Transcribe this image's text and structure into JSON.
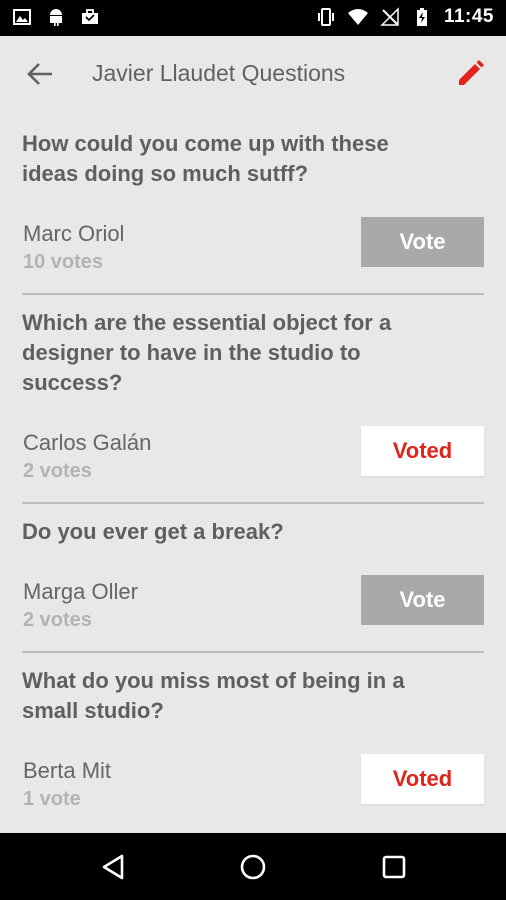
{
  "status_bar": {
    "time": "11:45",
    "left_icons": [
      "image-icon",
      "android-icon",
      "briefcase-icon"
    ],
    "right_icons": [
      "vibrate-icon",
      "wifi-icon",
      "no-signal-icon",
      "battery-charging-icon"
    ]
  },
  "toolbar": {
    "title": "Javier Llaudet Questions",
    "back_icon": "back-arrow-icon",
    "edit_icon": "pencil-icon"
  },
  "colors": {
    "accent": "#e2231a",
    "background": "#e8e8e8",
    "vote_button": "#a9a9a9"
  },
  "questions": [
    {
      "text": "How could you come up with these ideas doing so much sutff?",
      "author": "Marc Oriol",
      "votes": "10 votes",
      "button_label": "Vote",
      "voted": false
    },
    {
      "text": "Which are the essential object for a designer to have in the studio to success?",
      "author": "Carlos Galán",
      "votes": "2 votes",
      "button_label": "Voted",
      "voted": true
    },
    {
      "text": "Do you ever get a break?",
      "author": "Marga Oller",
      "votes": "2 votes",
      "button_label": "Vote",
      "voted": false
    },
    {
      "text": "What do you miss most of being in a small studio?",
      "author": "Berta Mit",
      "votes": "1 vote",
      "button_label": "Voted",
      "voted": true
    }
  ],
  "nav_bar": {
    "icons": [
      "back-triangle-icon",
      "home-circle-icon",
      "recents-square-icon"
    ]
  }
}
